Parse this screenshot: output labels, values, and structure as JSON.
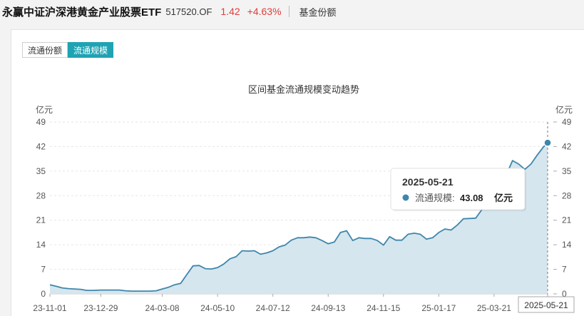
{
  "header": {
    "fund_name": "永赢中证沪深港黄金产业股票ETF",
    "fund_code": "517520.OF",
    "price": "1.42",
    "change": "+4.63%",
    "section": "基金份额"
  },
  "tabs": [
    {
      "label": "流通份额",
      "active": false
    },
    {
      "label": "流通规模",
      "active": true
    }
  ],
  "colors": {
    "accent": "#1fa3b3",
    "up": "#e03c3c",
    "line": "#3f86ab",
    "area": "#d5e6ee"
  },
  "chart_data": {
    "type": "area",
    "title": "区间基金流通规模变动趋势",
    "y_unit_left": "亿元",
    "y_unit_right": "亿元",
    "ylim": [
      0,
      49
    ],
    "yticks": [
      0,
      7,
      14,
      21,
      28,
      35,
      42,
      49
    ],
    "xlim": [
      "2023-11-01",
      "2025-05-21"
    ],
    "xtick_labels": [
      "23-11-01",
      "23-12-29",
      "24-03-08",
      "24-05-10",
      "24-07-12",
      "24-09-13",
      "24-11-15",
      "25-01-17",
      "25-03-21",
      "2025-05-21"
    ],
    "xtick_dates": [
      "2023-11-01",
      "2023-12-29",
      "2024-03-08",
      "2024-05-10",
      "2024-07-12",
      "2024-09-13",
      "2024-11-15",
      "2025-01-17",
      "2025-03-21",
      "2025-05-21"
    ],
    "grid": true,
    "series": [
      {
        "points": [
          [
            "2023-11-01",
            2.6
          ],
          [
            "2023-11-08",
            2.2
          ],
          [
            "2023-11-15",
            1.7
          ],
          [
            "2023-11-22",
            1.5
          ],
          [
            "2023-11-29",
            1.4
          ],
          [
            "2023-12-06",
            1.3
          ],
          [
            "2023-12-13",
            1.0
          ],
          [
            "2023-12-20",
            1.0
          ],
          [
            "2023-12-29",
            1.1
          ],
          [
            "2024-01-05",
            1.1
          ],
          [
            "2024-01-12",
            1.1
          ],
          [
            "2024-01-19",
            1.1
          ],
          [
            "2024-01-26",
            0.9
          ],
          [
            "2024-02-02",
            0.8
          ],
          [
            "2024-02-16",
            0.8
          ],
          [
            "2024-02-23",
            0.8
          ],
          [
            "2024-03-01",
            0.9
          ],
          [
            "2024-03-08",
            1.4
          ],
          [
            "2024-03-15",
            1.9
          ],
          [
            "2024-03-22",
            2.6
          ],
          [
            "2024-03-29",
            3.0
          ],
          [
            "2024-04-05",
            5.5
          ],
          [
            "2024-04-12",
            8.0
          ],
          [
            "2024-04-19",
            8.1
          ],
          [
            "2024-04-26",
            7.2
          ],
          [
            "2024-05-03",
            7.1
          ],
          [
            "2024-05-10",
            7.5
          ],
          [
            "2024-05-17",
            8.5
          ],
          [
            "2024-05-24",
            10.0
          ],
          [
            "2024-05-31",
            10.6
          ],
          [
            "2024-06-07",
            12.3
          ],
          [
            "2024-06-14",
            12.2
          ],
          [
            "2024-06-21",
            12.3
          ],
          [
            "2024-06-28",
            11.3
          ],
          [
            "2024-07-05",
            11.7
          ],
          [
            "2024-07-12",
            12.3
          ],
          [
            "2024-07-19",
            13.4
          ],
          [
            "2024-07-26",
            13.9
          ],
          [
            "2024-08-02",
            15.3
          ],
          [
            "2024-08-09",
            16.0
          ],
          [
            "2024-08-16",
            16.0
          ],
          [
            "2024-08-23",
            16.2
          ],
          [
            "2024-08-30",
            16.0
          ],
          [
            "2024-09-06",
            15.2
          ],
          [
            "2024-09-13",
            14.3
          ],
          [
            "2024-09-20",
            14.8
          ],
          [
            "2024-09-27",
            17.5
          ],
          [
            "2024-10-04",
            18.0
          ],
          [
            "2024-10-11",
            15.2
          ],
          [
            "2024-10-18",
            16.0
          ],
          [
            "2024-10-25",
            15.8
          ],
          [
            "2024-11-01",
            15.8
          ],
          [
            "2024-11-08",
            15.2
          ],
          [
            "2024-11-15",
            13.9
          ],
          [
            "2024-11-22",
            16.3
          ],
          [
            "2024-11-29",
            15.3
          ],
          [
            "2024-12-06",
            15.3
          ],
          [
            "2024-12-13",
            17.0
          ],
          [
            "2024-12-20",
            17.3
          ],
          [
            "2024-12-27",
            17.0
          ],
          [
            "2025-01-03",
            15.6
          ],
          [
            "2025-01-10",
            16.0
          ],
          [
            "2025-01-17",
            17.5
          ],
          [
            "2025-01-24",
            18.5
          ],
          [
            "2025-01-31",
            18.2
          ],
          [
            "2025-02-07",
            19.6
          ],
          [
            "2025-02-14",
            21.4
          ],
          [
            "2025-02-21",
            21.5
          ],
          [
            "2025-02-28",
            21.6
          ],
          [
            "2025-03-07",
            24.0
          ],
          [
            "2025-03-14",
            27.0
          ],
          [
            "2025-03-21",
            29.0
          ],
          [
            "2025-03-28",
            31.0
          ],
          [
            "2025-04-04",
            34.0
          ],
          [
            "2025-04-11",
            38.0
          ],
          [
            "2025-04-18",
            37.0
          ],
          [
            "2025-04-25",
            35.5
          ],
          [
            "2025-05-02",
            37.0
          ],
          [
            "2025-05-09",
            39.5
          ],
          [
            "2025-05-16",
            41.8
          ],
          [
            "2025-05-21",
            43.08
          ]
        ]
      }
    ],
    "tooltip": {
      "date": "2025-05-21",
      "label": "流通规模:",
      "value": "43.08",
      "unit": "亿元"
    }
  }
}
